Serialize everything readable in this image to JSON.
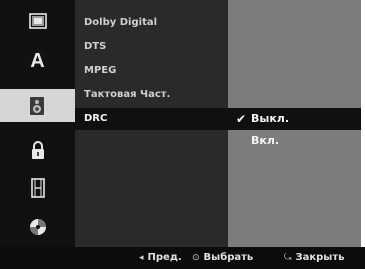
{
  "sidebar": {
    "icons": [
      {
        "name": "disc-tray-icon",
        "glyph": ""
      },
      {
        "name": "language-icon",
        "glyph": "A"
      },
      {
        "name": "speaker-icon",
        "glyph": ""
      },
      {
        "name": "lock-icon",
        "glyph": ""
      },
      {
        "name": "film-icon",
        "glyph": ""
      },
      {
        "name": "disc-icon",
        "glyph": ""
      }
    ],
    "active_index": 2
  },
  "menu": {
    "items": [
      "Dolby Digital",
      "DTS",
      "MPEG",
      "Тактовая Част.",
      "DRC"
    ],
    "selected_index": 4
  },
  "values": {
    "items": [
      {
        "label": "Выкл.",
        "checked": true
      },
      {
        "label": "Вкл.",
        "checked": false
      }
    ]
  },
  "footer": {
    "prev_icon": "◂",
    "prev_label": "Пред.",
    "select_icon": "⊙",
    "select_label": "Выбрать",
    "close_icon": "⤿",
    "close_label": "Закрыть"
  },
  "colors": {
    "panel": "#2a2a2a",
    "highlight": "#101010",
    "value_bg": "#7c7c7c",
    "icon_active": "#d6d6d6"
  }
}
